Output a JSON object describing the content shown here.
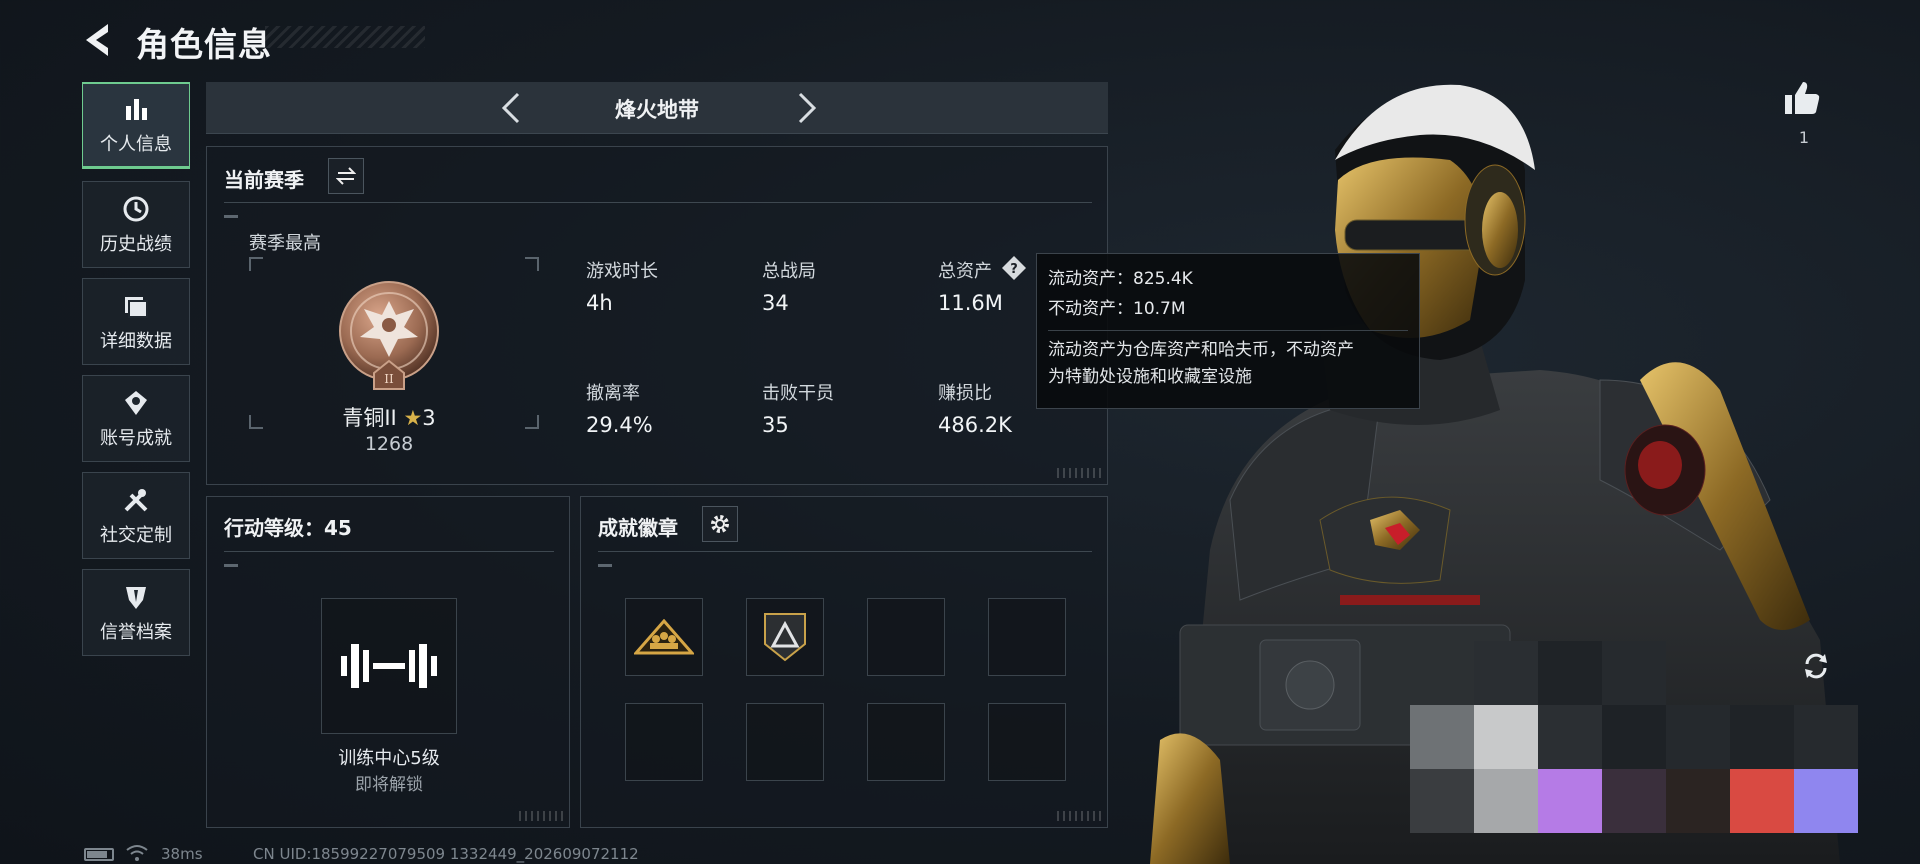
{
  "header": {
    "title": "角色信息"
  },
  "sidebar": {
    "items": [
      {
        "label": "个人信息",
        "active": true
      },
      {
        "label": "历史战绩"
      },
      {
        "label": "详细数据"
      },
      {
        "label": "账号成就"
      },
      {
        "label": "社交定制"
      },
      {
        "label": "信誉档案"
      }
    ]
  },
  "mode": {
    "title": "烽火地带"
  },
  "season": {
    "title": "当前赛季",
    "best_label": "赛季最高",
    "rank_name": "青铜II",
    "rank_stars": "3",
    "rank_score": "1268",
    "rank_numeral": "II",
    "stats": [
      {
        "label": "游戏时长",
        "value": "4h"
      },
      {
        "label": "总战局",
        "value": "34"
      },
      {
        "label": "总资产",
        "value": "11.6M"
      },
      {
        "label": "撤离率",
        "value": "29.4%"
      },
      {
        "label": "击败干员",
        "value": "35"
      },
      {
        "label": "赚损比",
        "value": "486.2K"
      }
    ]
  },
  "tooltip": {
    "liquid": "流动资产：825.4K",
    "fixed": "不动资产：10.7M",
    "desc_line1": "流动资产为仓库资产和哈夫币，不动资产",
    "desc_line2": "为特勤处设施和收藏室设施"
  },
  "action_level": {
    "title": "行动等级：45",
    "item_name": "训练中心5级",
    "item_status": "即将解锁"
  },
  "achievements": {
    "title": "成就徽章"
  },
  "status_bar": {
    "ping": "38ms",
    "uid": "CN UID:18599227079509 1332449_202609072112"
  },
  "like": {
    "count": "1"
  },
  "colors": {
    "accent_green": "#6ecb8f",
    "panel_border": "#3a434c",
    "gold": "#c9a24a",
    "rank_bronze": "#9b6a52"
  },
  "icons": [
    "back-arrow-icon",
    "bar-chart-icon",
    "clock-icon",
    "folder-icon",
    "achievement-icon",
    "tools-icon",
    "shield-icon",
    "swap-icon",
    "question-icon",
    "gear-icon",
    "thumbs-up-icon",
    "rotate-icon",
    "dumbbell-icon"
  ]
}
